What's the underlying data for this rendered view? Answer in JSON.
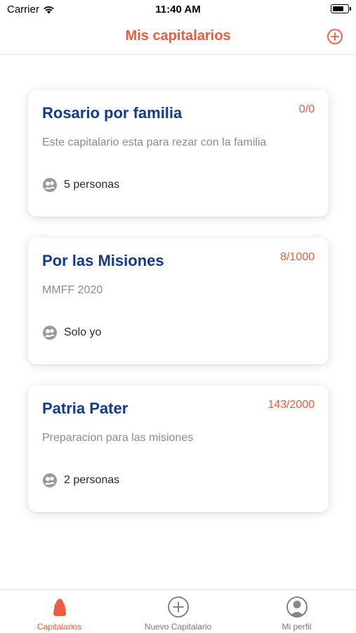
{
  "status_bar": {
    "carrier": "Carrier",
    "time": "11:40 AM"
  },
  "nav": {
    "title": "Mis capitalarios",
    "add_icon": "plus-circle-icon"
  },
  "cards": [
    {
      "title": "Rosario por familia",
      "count": "0/0",
      "description": "Este capitalario esta para rezar con la familia",
      "members": "5 personas"
    },
    {
      "title": "Por las Misiones",
      "count": "8/1000",
      "description": "MMFF 2020",
      "members": "Solo yo"
    },
    {
      "title": "Patria Pater",
      "count": "143/2000",
      "description": "Preparacion para las misiones",
      "members": "2 personas"
    }
  ],
  "tabs": [
    {
      "label": "Capitalarios",
      "icon": "rose-bag-icon",
      "active": true
    },
    {
      "label": "Nuevo Capitalario",
      "icon": "plus-circle-icon",
      "active": false
    },
    {
      "label": "Mi perfil",
      "icon": "person-circle-icon",
      "active": false
    }
  ],
  "colors": {
    "accent": "#ef5b3d",
    "title_blue": "#143a8c",
    "muted": "#8c8c8c"
  }
}
